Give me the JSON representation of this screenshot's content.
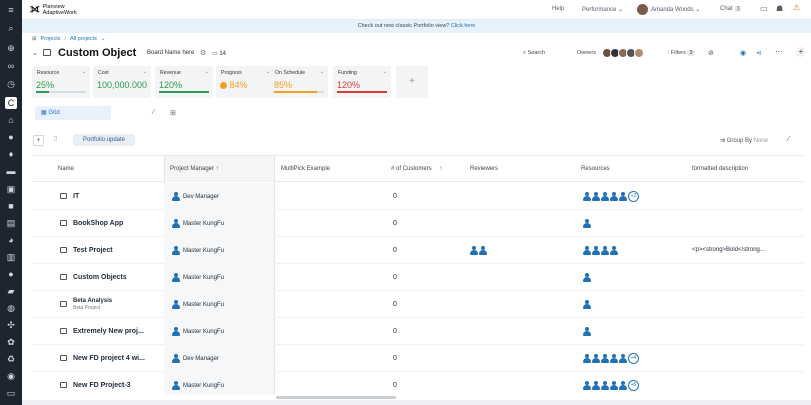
{
  "app": {
    "logo_line1": "Planview",
    "logo_line2": "AdaptiveWork"
  },
  "topbar": {
    "help": "Help",
    "performance": "Performance",
    "user": "Amanda Woods",
    "chat": "Chat",
    "chat_count": "3"
  },
  "banner": {
    "text": "Check out new classic Portfolio view?",
    "link": "Click here"
  },
  "breadcrumb": {
    "items": [
      "Projects",
      "All projects"
    ]
  },
  "header": {
    "title": "Custom Object",
    "board": "Board Name here",
    "count": "14",
    "search": "Search",
    "owners": "Owners",
    "filters": "Filters",
    "filters_count": "3"
  },
  "cards": [
    {
      "label": "Resource",
      "value": "25%",
      "color": "#2e9a4b",
      "fill": 0.25
    },
    {
      "label": "Cost",
      "value": "100,000.000",
      "color": "#2e9a4b",
      "fill": 1.0
    },
    {
      "label": "Revenue",
      "value": "120%",
      "color": "#2e9a4b",
      "fill": 1.0
    },
    {
      "label": "Progress",
      "value": "84%",
      "color": "#f0a020",
      "fill": 0.84
    },
    {
      "label": "On Schedule",
      "value": "85%",
      "color": "#f0a020",
      "fill": 0.85
    },
    {
      "label": "Funding",
      "value": "120%",
      "color": "#d93a3a",
      "fill": 1.0
    }
  ],
  "view": {
    "tab": "Grid"
  },
  "toolbar": {
    "portfolio_update": "Portfolio update",
    "group_by": "Group By",
    "group_by_value": "None"
  },
  "columns": {
    "name": "Name",
    "project_manager": "Project Manager",
    "multipick": "MultiPick Example",
    "customers": "# of Customers",
    "reviewers": "Reviewers",
    "resources": "Resources",
    "description": "formatted description"
  },
  "rows": [
    {
      "name": "IT",
      "pm": "Dev Manager",
      "customers": "0",
      "reviewers": 0,
      "resources": 5,
      "extra": "+2",
      "description": ""
    },
    {
      "name": "BookShop App",
      "pm": "Master KungFu",
      "customers": "0",
      "reviewers": 0,
      "resources": 1,
      "extra": "",
      "description": ""
    },
    {
      "name": "Test Project",
      "pm": "Master KungFu",
      "customers": "0",
      "reviewers": 2,
      "resources": 4,
      "extra": "",
      "description": "<p><strong>Bold</strong..."
    },
    {
      "name": "Custom Objects",
      "pm": "Master KungFu",
      "customers": "0",
      "reviewers": 0,
      "resources": 1,
      "extra": "",
      "description": ""
    },
    {
      "name": "Beta Analysis",
      "sub": "Beta Project",
      "pm": "Master KungFu",
      "customers": "0",
      "reviewers": 0,
      "resources": 1,
      "extra": "",
      "description": ""
    },
    {
      "name": "Extremely New proj...",
      "pm": "Master KungFu",
      "customers": "0",
      "reviewers": 0,
      "resources": 1,
      "extra": "",
      "description": ""
    },
    {
      "name": "New FD project 4 wi...",
      "pm": "Dev Manager",
      "customers": "0",
      "reviewers": 0,
      "resources": 5,
      "extra": "+4",
      "description": ""
    },
    {
      "name": "New FD Project-3",
      "pm": "Master KungFu",
      "customers": "0",
      "reviewers": 0,
      "resources": 5,
      "extra": "+5",
      "description": ""
    }
  ]
}
